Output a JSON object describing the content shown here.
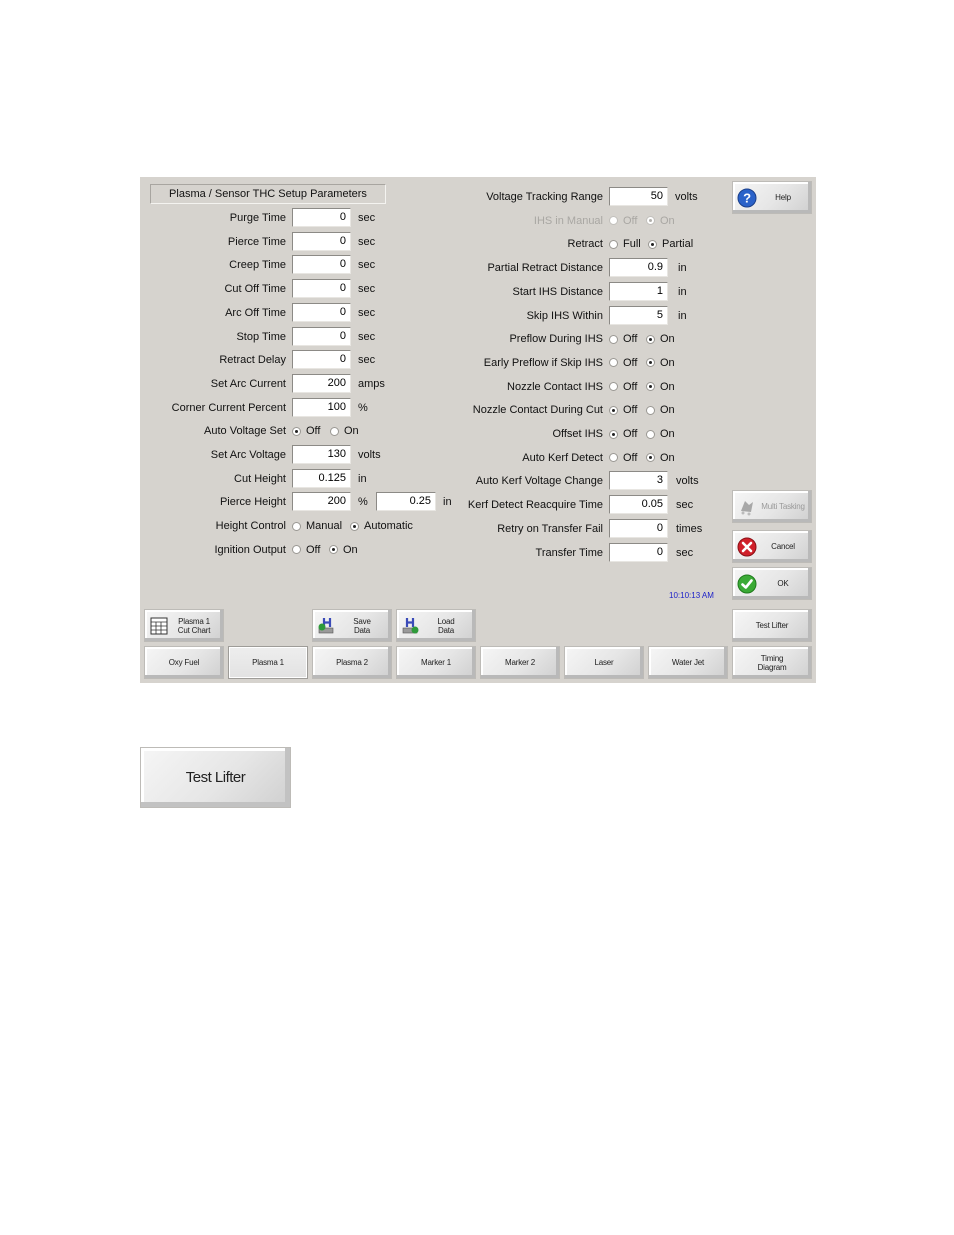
{
  "panel": {
    "title": "Plasma / Sensor THC Setup Parameters",
    "left_fields": [
      {
        "label": "Purge Time",
        "value": "0",
        "unit": "sec"
      },
      {
        "label": "Pierce Time",
        "value": "0",
        "unit": "sec"
      },
      {
        "label": "Creep Time",
        "value": "0",
        "unit": "sec"
      },
      {
        "label": "Cut Off Time",
        "value": "0",
        "unit": "sec"
      },
      {
        "label": "Arc Off Time",
        "value": "0",
        "unit": "sec"
      },
      {
        "label": "Stop Time",
        "value": "0",
        "unit": "sec"
      },
      {
        "label": "Retract Delay",
        "value": "0",
        "unit": "sec"
      },
      {
        "label": "Set Arc Current",
        "value": "200",
        "unit": "amps"
      },
      {
        "label": "Corner Current Percent",
        "value": "100",
        "unit": "%"
      }
    ],
    "auto_voltage_set": {
      "label": "Auto Voltage Set",
      "options": [
        "Off",
        "On"
      ],
      "selected": "Off"
    },
    "left_fields_2": [
      {
        "label": "Set Arc Voltage",
        "value": "130",
        "unit": "volts"
      },
      {
        "label": "Cut Height",
        "value": "0.125",
        "unit": "in"
      }
    ],
    "pierce_height": {
      "label": "Pierce Height",
      "value": "200",
      "unit": "%",
      "value2": "0.25",
      "unit2": "in"
    },
    "height_control": {
      "label": "Height Control",
      "options": [
        "Manual",
        "Automatic"
      ],
      "selected": "Automatic"
    },
    "ignition_output": {
      "label": "Ignition Output",
      "options": [
        "Off",
        "On"
      ],
      "selected": "On"
    },
    "voltage_tracking_range": {
      "label": "Voltage Tracking Range",
      "value": "50",
      "unit": "volts"
    },
    "ihs_in_manual": {
      "label": "IHS in Manual",
      "options": [
        "Off",
        "On"
      ],
      "selected": "On",
      "disabled": true
    },
    "retract": {
      "label": "Retract",
      "options": [
        "Full",
        "Partial"
      ],
      "selected": "Partial"
    },
    "right_fields": [
      {
        "label": "Partial Retract Distance",
        "value": "0.9",
        "unit": "in"
      },
      {
        "label": "Start IHS Distance",
        "value": "1",
        "unit": "in"
      },
      {
        "label": "Skip IHS Within",
        "value": "5",
        "unit": "in"
      }
    ],
    "right_radios": [
      {
        "label": "Preflow During IHS",
        "options": [
          "Off",
          "On"
        ],
        "selected": "On"
      },
      {
        "label": "Early Preflow if Skip IHS",
        "options": [
          "Off",
          "On"
        ],
        "selected": "On"
      },
      {
        "label": "Nozzle Contact IHS",
        "options": [
          "Off",
          "On"
        ],
        "selected": "On"
      },
      {
        "label": "Nozzle Contact During Cut",
        "options": [
          "Off",
          "On"
        ],
        "selected": "Off"
      },
      {
        "label": "Offset IHS",
        "options": [
          "Off",
          "On"
        ],
        "selected": "Off"
      },
      {
        "label": "Auto Kerf Detect",
        "options": [
          "Off",
          "On"
        ],
        "selected": "On"
      }
    ],
    "right_fields_2": [
      {
        "label": "Auto Kerf Voltage Change",
        "value": "3",
        "unit": "volts"
      },
      {
        "label": "Kerf Detect Reacquire Time",
        "value": "0.05",
        "unit": "sec"
      },
      {
        "label": "Retry on Transfer Fail",
        "value": "0",
        "unit": "times"
      },
      {
        "label": "Transfer Time",
        "value": "0",
        "unit": "sec"
      }
    ],
    "clock": "10:10:13 AM"
  },
  "side_buttons": {
    "help": "Help",
    "multi_tasking": "Multi Tasking",
    "cancel": "Cancel",
    "ok": "OK",
    "test_lifter": "Test Lifter"
  },
  "toolbar": {
    "cut_chart": [
      "Plasma 1",
      "Cut Chart"
    ],
    "save_data": [
      "Save",
      "Data"
    ],
    "load_data": [
      "Load",
      "Data"
    ]
  },
  "tabs": [
    {
      "label": "Oxy Fuel",
      "selected": false
    },
    {
      "label": "Plasma 1",
      "selected": true
    },
    {
      "label": "Plasma 2",
      "selected": false
    },
    {
      "label": "Marker 1",
      "selected": false
    },
    {
      "label": "Marker 2",
      "selected": false
    },
    {
      "label": "Laser",
      "selected": false
    },
    {
      "label": "Water Jet",
      "selected": false
    }
  ],
  "timing_diagram": [
    "Timing",
    "Diagram"
  ],
  "callout_button": "Test Lifter"
}
